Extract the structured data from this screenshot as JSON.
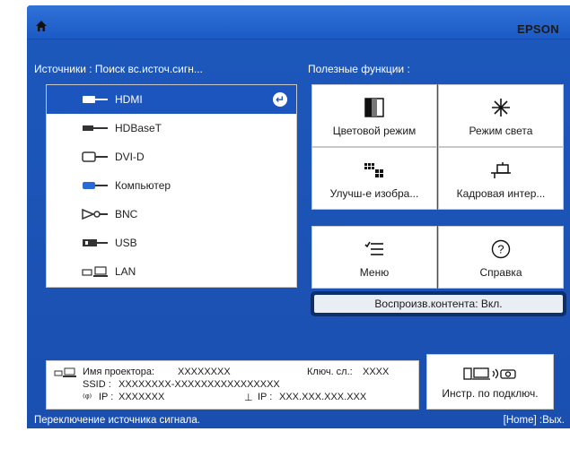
{
  "header": {
    "brand": "EPSON",
    "home_icon": "home-icon"
  },
  "sources": {
    "label": "Источники : Поиск вс.источ.сигн...",
    "items": [
      {
        "label": "HDMI",
        "icon": "hdmi-icon",
        "selected": true
      },
      {
        "label": "HDBaseT",
        "icon": "hdbaset-icon",
        "selected": false
      },
      {
        "label": "DVI-D",
        "icon": "dvi-icon",
        "selected": false
      },
      {
        "label": "Компьютер",
        "icon": "computer-vga-icon",
        "selected": false
      },
      {
        "label": "BNC",
        "icon": "bnc-icon",
        "selected": false
      },
      {
        "label": "USB",
        "icon": "usb-icon",
        "selected": false
      },
      {
        "label": "LAN",
        "icon": "lan-icon",
        "selected": false
      }
    ]
  },
  "functions": {
    "label": "Полезные функции :",
    "items": [
      {
        "label": "Цветовой режим",
        "icon": "color-mode-icon"
      },
      {
        "label": "Режим света",
        "icon": "light-mode-icon"
      },
      {
        "label": "Улучш-е изобра...",
        "icon": "image-enhance-icon"
      },
      {
        "label": "Кадровая интер...",
        "icon": "frame-interpolation-icon"
      },
      {
        "label": "Меню",
        "icon": "menu-icon"
      },
      {
        "label": "Справка",
        "icon": "help-icon"
      }
    ],
    "content_playback": "Воспроизв.контента: Вкл."
  },
  "info": {
    "projector_name_label": "Имя проектора:",
    "projector_name_value": "XXXXXXXX",
    "key_label": "Ключ. сл.:",
    "key_value": "XXXX",
    "ssid_label": "SSID :",
    "ssid_value": "XXXXXXXX-XXXXXXXXXXXXXXXX",
    "ip_wireless_label": "IP :",
    "ip_wireless_value": "XXXXXXX",
    "ip_wired_label": "IP :",
    "ip_wired_value": "XXX.XXX.XXX.XXX"
  },
  "connection": {
    "label": "Инстр. по подключ.",
    "icon": "connection-guide-icon"
  },
  "status": {
    "left": "Переключение источника сигнала.",
    "right": "[Home] :Вых."
  },
  "colors": {
    "background": "#1d58bc",
    "selected": "#1c55bd",
    "highlight_border": "#0d2f6e"
  }
}
